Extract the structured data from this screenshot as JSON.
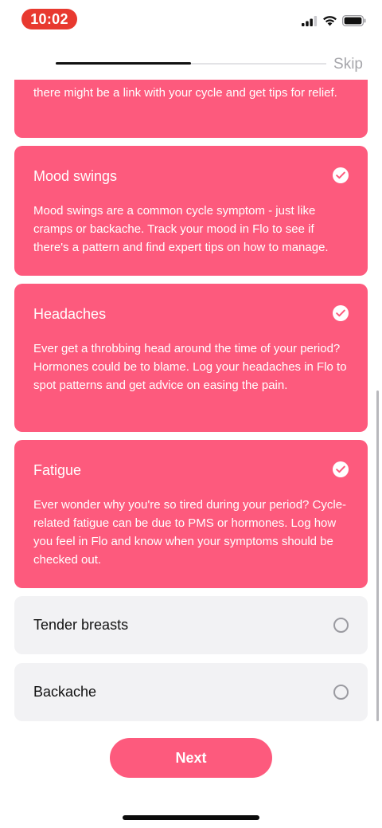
{
  "status_bar": {
    "time": "10:02"
  },
  "header": {
    "progress_fraction": 0.5,
    "skip_label": "Skip"
  },
  "cards": [
    {
      "title": "",
      "description_partial": "there might be a link with your cycle and get tips for relief.",
      "selected": true
    },
    {
      "title": "Mood swings",
      "description": "Mood swings are a common cycle symptom - just like cramps or backache. Track your mood in Flo to see if there's a pattern and find expert tips on how to manage.",
      "selected": true
    },
    {
      "title": "Headaches",
      "description": "Ever get a throbbing head around the time of your period? Hormones could be to blame. Log your headaches in Flo to spot patterns and get advice on easing the pain.",
      "selected": true
    },
    {
      "title": "Fatigue",
      "description": "Ever wonder why you're so tired during your period? Cycle-related fatigue can be due to PMS or hormones. Log how you feel in Flo and know when your symptoms should be checked out.",
      "selected": true
    },
    {
      "title": "Tender breasts",
      "selected": false
    },
    {
      "title": "Backache",
      "selected": false
    }
  ],
  "footer": {
    "next_label": "Next"
  },
  "colors": {
    "accent": "#fd5a7d",
    "time_pill": "#e8392f",
    "unselected_card": "#f2f2f4"
  }
}
